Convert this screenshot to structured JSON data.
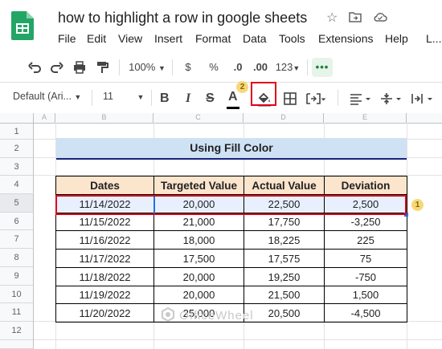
{
  "app": {
    "title": "how to highlight a row in google sheets",
    "icons": [
      "star-icon",
      "move-to-folder-icon",
      "cloud-status-icon"
    ]
  },
  "menu": [
    "File",
    "Edit",
    "View",
    "Insert",
    "Format",
    "Data",
    "Tools",
    "Extensions",
    "Help",
    "L..."
  ],
  "toolbar1": {
    "zoom": "100%",
    "currency": "$",
    "percent": "%",
    "decrease_decimal": ".0",
    "increase_decimal": ".00",
    "number_format": "123",
    "more": "•••"
  },
  "toolbar2": {
    "font": "Default (Ari...",
    "font_size": "11",
    "bold": "B",
    "italic": "I",
    "strike": "S",
    "text_color": "A",
    "badge": "2"
  },
  "grid": {
    "column_headers": [
      "A",
      "B",
      "C",
      "D",
      "E"
    ],
    "row_numbers": [
      "1",
      "2",
      "3",
      "4",
      "5",
      "6",
      "7",
      "8",
      "9",
      "10",
      "11",
      "12"
    ]
  },
  "sheet": {
    "heading": "Using Fill Color",
    "table": {
      "headers": [
        "Dates",
        "Targeted Value",
        "Actual Value",
        "Deviation"
      ],
      "rows": [
        [
          "11/14/2022",
          "20,000",
          "22,500",
          "2,500"
        ],
        [
          "11/15/2022",
          "21,000",
          "17,750",
          "-3,250"
        ],
        [
          "11/16/2022",
          "18,000",
          "18,225",
          "225"
        ],
        [
          "11/17/2022",
          "17,500",
          "17,575",
          "75"
        ],
        [
          "11/18/2022",
          "20,000",
          "19,250",
          "-750"
        ],
        [
          "11/19/2022",
          "20,000",
          "21,500",
          "1,500"
        ],
        [
          "11/20/2022",
          "25,000",
          "20,500",
          "-4,500"
        ]
      ]
    },
    "row_badge": "1"
  },
  "watermark": "OfficeWheel",
  "colors": {
    "heading_fill": "#cfe2f3",
    "header_fill": "#fce5cd",
    "highlight_border": "#e0001b",
    "badge": "#f6d87a",
    "selected_row": "#e8f0fe"
  }
}
